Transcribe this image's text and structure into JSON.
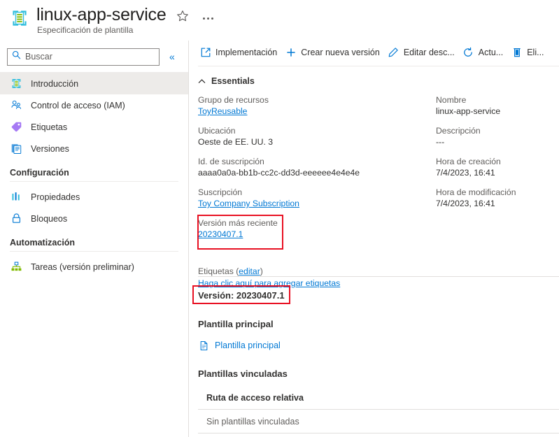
{
  "header": {
    "title": "linux-app-service",
    "subtitle": "Especificación de plantilla",
    "resource_icon": "template-spec-icon",
    "favorite_icon": "star-icon",
    "more_icon": "ellipsis-icon"
  },
  "sidebar": {
    "search": {
      "placeholder": "Buscar",
      "value": "",
      "icon": "search-icon"
    },
    "collapse_label": "«",
    "items": [
      {
        "label": "Introducción",
        "icon": "template-spec-icon",
        "selected": true
      },
      {
        "label": "Control de acceso (IAM)",
        "icon": "access-control-icon",
        "selected": false
      },
      {
        "label": "Etiquetas",
        "icon": "tag-icon",
        "selected": false
      },
      {
        "label": "Versiones",
        "icon": "versions-icon",
        "selected": false
      }
    ],
    "groups": [
      {
        "title": "Configuración",
        "items": [
          {
            "label": "Propiedades",
            "icon": "properties-icon"
          },
          {
            "label": "Bloqueos",
            "icon": "lock-icon"
          }
        ]
      },
      {
        "title": "Automatización",
        "items": [
          {
            "label": "Tareas (versión preliminar)",
            "icon": "tasks-icon"
          }
        ]
      }
    ]
  },
  "main": {
    "commands": [
      {
        "label": "Implementación",
        "icon": "deploy-icon"
      },
      {
        "label": "Crear nueva versión",
        "icon": "plus-icon"
      },
      {
        "label": "Editar desc...",
        "icon": "pencil-icon"
      },
      {
        "label": "Actu...",
        "icon": "refresh-icon"
      },
      {
        "label": "Eli...",
        "icon": "delete-icon"
      }
    ],
    "essentials": {
      "title": "Essentials",
      "collapse_icon": "chevron-up-icon",
      "left_fields": [
        {
          "label": "Grupo de recursos",
          "value": "ToyReusable",
          "is_link": true
        },
        {
          "label": "Ubicación",
          "value": "Oeste de EE. UU. 3",
          "is_link": false
        },
        {
          "label": "Id. de suscripción",
          "value": "aaaa0a0a-bb1b-cc2c-dd3d-eeeeee4e4e4e",
          "is_link": false
        },
        {
          "label": "Suscripción",
          "value": "Toy Company Subscription",
          "is_link": true
        },
        {
          "label": "Versión más reciente",
          "value": "20230407.1",
          "is_link": true,
          "highlighted": true
        }
      ],
      "right_fields": [
        {
          "label": "Nombre",
          "value": "linux-app-service",
          "is_link": false
        },
        {
          "label": "Descripción",
          "value": "---",
          "is_link": false
        },
        {
          "label": "Hora de creación",
          "value": "7/4/2023, 16:41",
          "is_link": false
        },
        {
          "label": "Hora de modificación",
          "value": "7/4/2023, 16:41",
          "is_link": false
        }
      ],
      "tags": {
        "label_prefix": "Etiquetas (",
        "edit_label": "editar",
        "label_suffix": ")",
        "add_link": "Haga clic aquí para agregar etiquetas"
      }
    },
    "version_section": {
      "heading": "Versión: 20230407.1",
      "highlighted": true
    },
    "main_template": {
      "heading": "Plantilla principal",
      "link_label": "Plantilla principal",
      "link_icon": "file-icon"
    },
    "linked_templates": {
      "heading": "Plantillas vinculadas",
      "column_header": "Ruta de acceso relativa",
      "empty_message": "Sin plantillas vinculadas"
    }
  },
  "colors": {
    "accent": "#0078d4",
    "highlight_box": "#e81123",
    "selected_nav": "#edebe9",
    "muted_text": "#605e5c"
  }
}
